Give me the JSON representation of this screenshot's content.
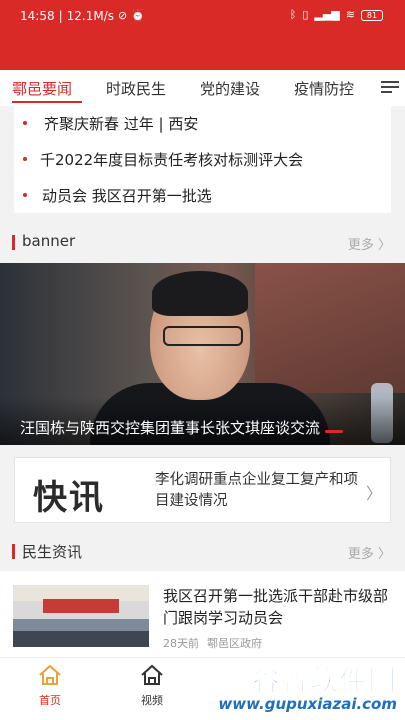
{
  "status_bar": {
    "time": "14:58",
    "network_speed": "12.1M/s",
    "battery": "81"
  },
  "tabs": [
    {
      "label": "鄠邑要闻",
      "active": true
    },
    {
      "label": "时政民生",
      "active": false
    },
    {
      "label": "党的建设",
      "active": false
    },
    {
      "label": "疫情防控",
      "active": false
    }
  ],
  "headlines": [
    {
      "text": "齐聚庆新春                  过年  |  西安"
    },
    {
      "text": "千2022年度目标责任考核对标测评大会"
    },
    {
      "text": "动员会                  我区召开第一批选"
    }
  ],
  "banner_section": {
    "title": "banner",
    "more": "更多 〉",
    "caption": "汪国栋与陕西交控集团董事长张文琪座谈交流"
  },
  "kuaixun": {
    "logo_text": "快讯",
    "text": "李化调研重点企业复工复产和项目建设情况"
  },
  "minsheng_section": {
    "title": "民生资讯",
    "more": "更多 〉"
  },
  "news_items": [
    {
      "title": "我区召开第一批选派干部赴市级部门跟岗学习动员会",
      "time": "28天前",
      "source": "鄠邑区政府"
    }
  ],
  "bottom_nav": [
    {
      "label": "首页",
      "icon": "home-icon",
      "active": true
    },
    {
      "label": "视频",
      "icon": "video-home-icon",
      "active": false
    }
  ],
  "watermark": {
    "title": "谷普软件园",
    "url": "www.gupuxiazai.com"
  },
  "colors": {
    "primary": "#d92a28",
    "background": "#f2f2f2"
  }
}
